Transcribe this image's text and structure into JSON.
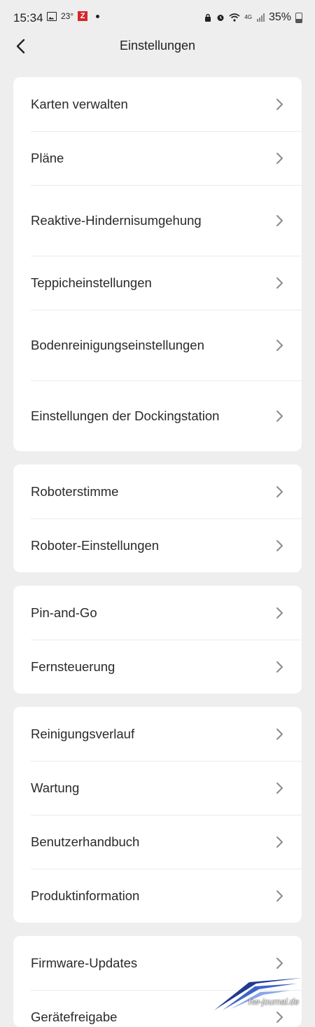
{
  "status_bar": {
    "time": "15:34",
    "temperature": "23°",
    "z_badge": "Z",
    "network": "4G",
    "battery": "35%"
  },
  "header": {
    "title": "Einstellungen",
    "back_icon": "chevron-left-icon"
  },
  "groups": [
    {
      "items": [
        "Karten verwalten",
        "Pläne",
        "Reaktive-Hindernisumgehung",
        "Teppicheinstellungen",
        "Bodenreinigungseinstellungen",
        "Einstellungen der Dockingstation"
      ]
    },
    {
      "items": [
        "Roboterstimme",
        "Roboter-Einstellungen"
      ]
    },
    {
      "items": [
        "Pin-and-Go",
        "Fernsteuerung"
      ]
    },
    {
      "items": [
        "Reinigungsverlauf",
        "Wartung",
        "Benutzerhandbuch",
        "Produktinformation"
      ]
    },
    {
      "items": [
        "Firmware-Updates",
        "Gerätefreigabe"
      ]
    }
  ],
  "watermark": {
    "text": "hw-journal.de"
  },
  "colors": {
    "background": "#eeeeee",
    "card": "#ffffff",
    "text": "#2a2a2a",
    "chevron": "#8a8a8a",
    "badge": "#d6262b"
  }
}
